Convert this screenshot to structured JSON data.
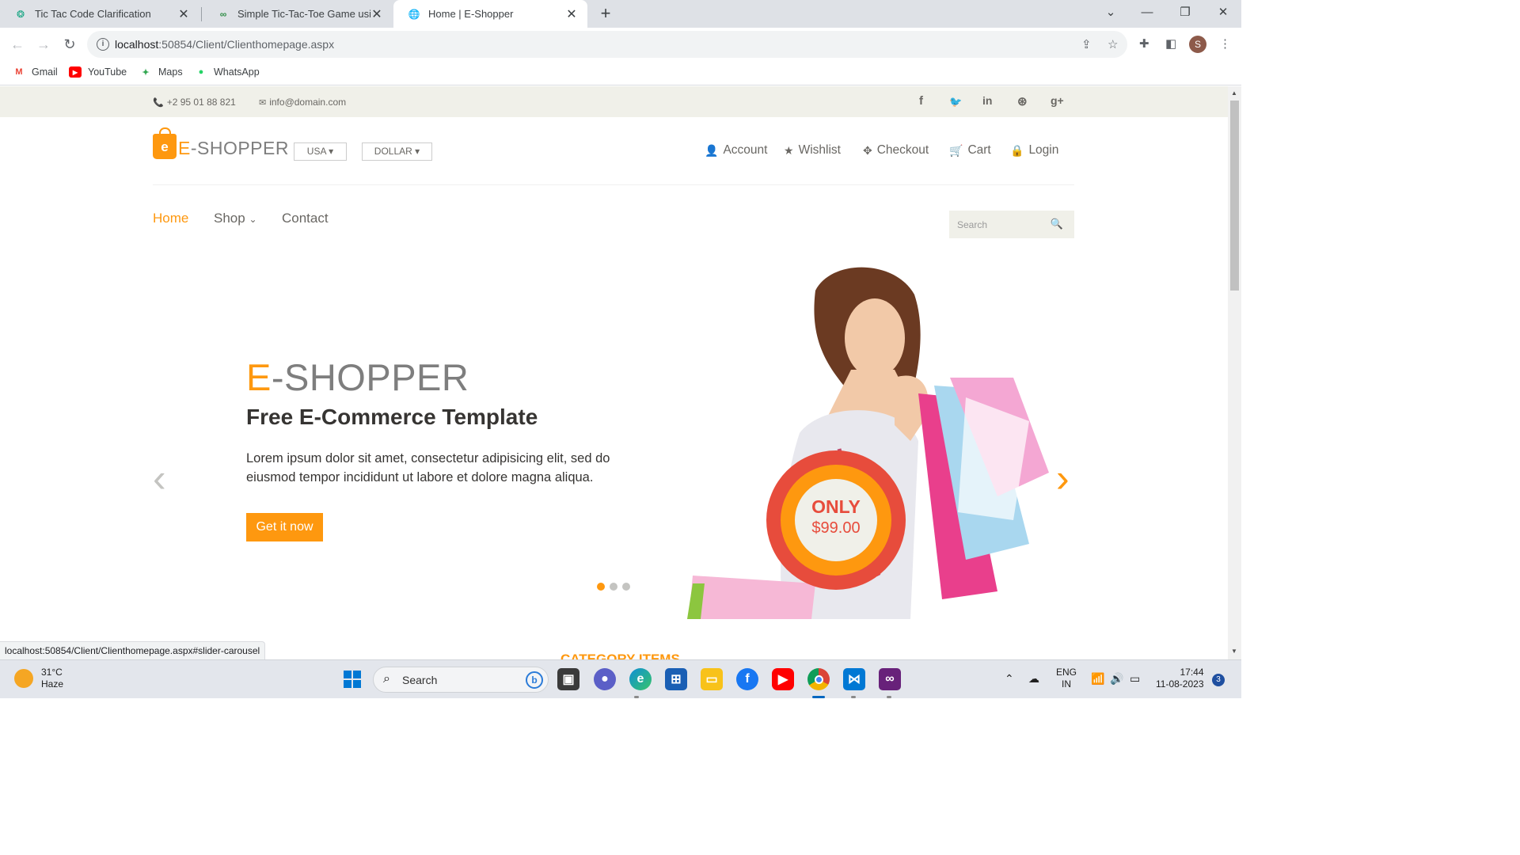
{
  "browser": {
    "tabs": [
      {
        "title": "Tic Tac Code Clarification",
        "icon": "chatgpt-icon"
      },
      {
        "title": "Simple Tic-Tac-Toe Game using J",
        "icon": "geeksforgeeks-icon"
      },
      {
        "title": "Home | E-Shopper",
        "icon": "globe-icon"
      }
    ],
    "url_host": "localhost",
    "url_path": ":50854/Client/Clienthomepage.aspx",
    "profile_initial": "S",
    "bookmarks": [
      {
        "label": "Gmail",
        "icon": "gmail-icon",
        "glyph": "M",
        "color": "#ea4335"
      },
      {
        "label": "YouTube",
        "icon": "youtube-icon",
        "glyph": "▶",
        "color": "#ff0000"
      },
      {
        "label": "Maps",
        "icon": "maps-icon",
        "glyph": "✦",
        "color": "#34a853"
      },
      {
        "label": "WhatsApp",
        "icon": "whatsapp-icon",
        "glyph": "●",
        "color": "#25d366"
      }
    ],
    "status_url": "localhost:50854/Client/Clienthomepage.aspx#slider-carousel"
  },
  "site": {
    "colors": {
      "accent": "#fe980f",
      "topbar": "#f0f0e9",
      "text": "#696763"
    },
    "topbar": {
      "phone": "+2 95 01 88 821",
      "email": "info@domain.com",
      "social": [
        {
          "name": "facebook-icon",
          "glyph": "f"
        },
        {
          "name": "twitter-icon",
          "glyph": "🐦"
        },
        {
          "name": "linkedin-icon",
          "glyph": "in"
        },
        {
          "name": "dribbble-icon",
          "glyph": "⊛"
        },
        {
          "name": "google-plus-icon",
          "glyph": "g+"
        }
      ]
    },
    "logo": {
      "e": "E",
      "rest": "-SHOPPER",
      "bag_letter": "e"
    },
    "country_dropdown": "USA",
    "currency_dropdown": "DOLLAR",
    "header_links": [
      {
        "label": "Account",
        "icon": "user-icon",
        "glyph": "👤"
      },
      {
        "label": "Wishlist",
        "icon": "star-icon",
        "glyph": "★"
      },
      {
        "label": "Checkout",
        "icon": "crosshairs-icon",
        "glyph": "✥"
      },
      {
        "label": "Cart",
        "icon": "cart-icon",
        "glyph": "🛒"
      },
      {
        "label": "Login",
        "icon": "lock-icon",
        "glyph": "🔒"
      }
    ],
    "nav": {
      "home": "Home",
      "shop": "Shop",
      "contact": "Contact"
    },
    "search_placeholder": "Search",
    "slider": {
      "title_e": "E",
      "title_rest": "-SHOPPER",
      "subtitle": "Free E-Commerce Template",
      "text": "Lorem ipsum dolor sit amet, consectetur adipisicing elit, sed do eiusmod tempor incididunt ut labore et dolore magna aliqua.",
      "button": "Get it now",
      "badge_only": "ONLY",
      "badge_price": "$99.00",
      "active_slide": 1,
      "slide_count": 3
    },
    "next_section_title": "CATEGORY ITEMS"
  },
  "taskbar": {
    "weather_temp": "31°C",
    "weather_desc": "Haze",
    "search_label": "Search",
    "language": "ENG",
    "region": "IN",
    "time": "17:44",
    "date": "11-08-2023",
    "notification_count": "3"
  }
}
